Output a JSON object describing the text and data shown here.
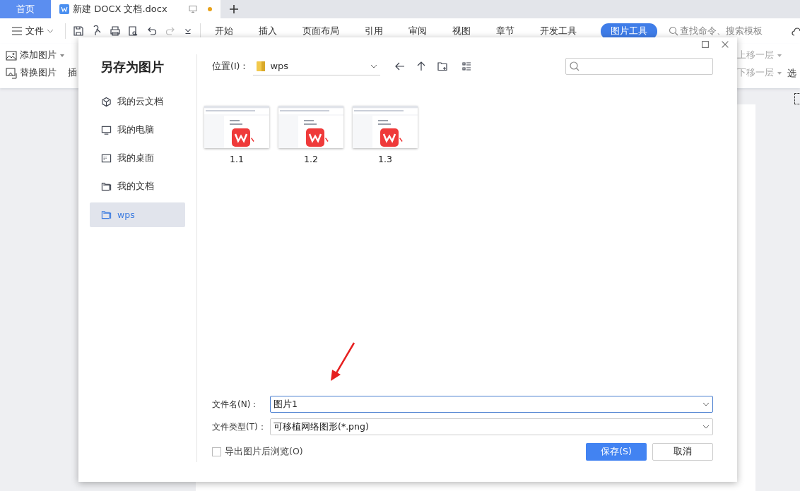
{
  "app": {
    "tabs": [
      {
        "label": "首页",
        "kind": "home",
        "selected": false
      },
      {
        "label": "新建 DOCX 文档.docx",
        "kind": "document",
        "selected": true,
        "unsaved": true
      }
    ],
    "file_menu": "文件",
    "ribbon_tabs": [
      {
        "label": "开始",
        "selected": false
      },
      {
        "label": "插入",
        "selected": false
      },
      {
        "label": "页面布局",
        "selected": false
      },
      {
        "label": "引用",
        "selected": false
      },
      {
        "label": "审阅",
        "selected": false
      },
      {
        "label": "视图",
        "selected": false
      },
      {
        "label": "章节",
        "selected": false
      },
      {
        "label": "开发工具",
        "selected": false
      },
      {
        "label": "图片工具",
        "selected": true
      }
    ],
    "search": {
      "placeholder": "查找命令、搜索模板"
    },
    "ribbon_left": [
      {
        "label": "添加图片",
        "kind": "add"
      },
      {
        "label": "替换图片",
        "kind": "replace"
      }
    ],
    "ribbon_cut": "插",
    "ribbon_right": [
      {
        "label": "上移一层"
      },
      {
        "label": "下移一层"
      }
    ],
    "ribbon_edge": "选"
  },
  "dialog": {
    "title": "另存为图片",
    "places": [
      {
        "label": "我的云文档",
        "kind": "cloud",
        "selected": false
      },
      {
        "label": "我的电脑",
        "kind": "computer",
        "selected": false
      },
      {
        "label": "我的桌面",
        "kind": "desktop",
        "selected": false
      },
      {
        "label": "我的文档",
        "kind": "documents",
        "selected": false
      },
      {
        "label": "wps",
        "kind": "folder",
        "selected": true
      }
    ],
    "location": {
      "label": "位置(I)：",
      "value": "wps"
    },
    "files": [
      {
        "name": "1.1"
      },
      {
        "name": "1.2"
      },
      {
        "name": "1.3"
      }
    ],
    "file_name": {
      "label": "文件名(N)：",
      "value": "图片1"
    },
    "file_type": {
      "label": "文件类型(T)：",
      "value": "可移植网络图形(*.png)"
    },
    "browse_after_export": {
      "label": "导出图片后浏览(O)",
      "checked": false
    },
    "buttons": [
      {
        "label": "保存(S)",
        "kind": "primary"
      },
      {
        "label": "取消",
        "kind": "secondary"
      }
    ]
  }
}
